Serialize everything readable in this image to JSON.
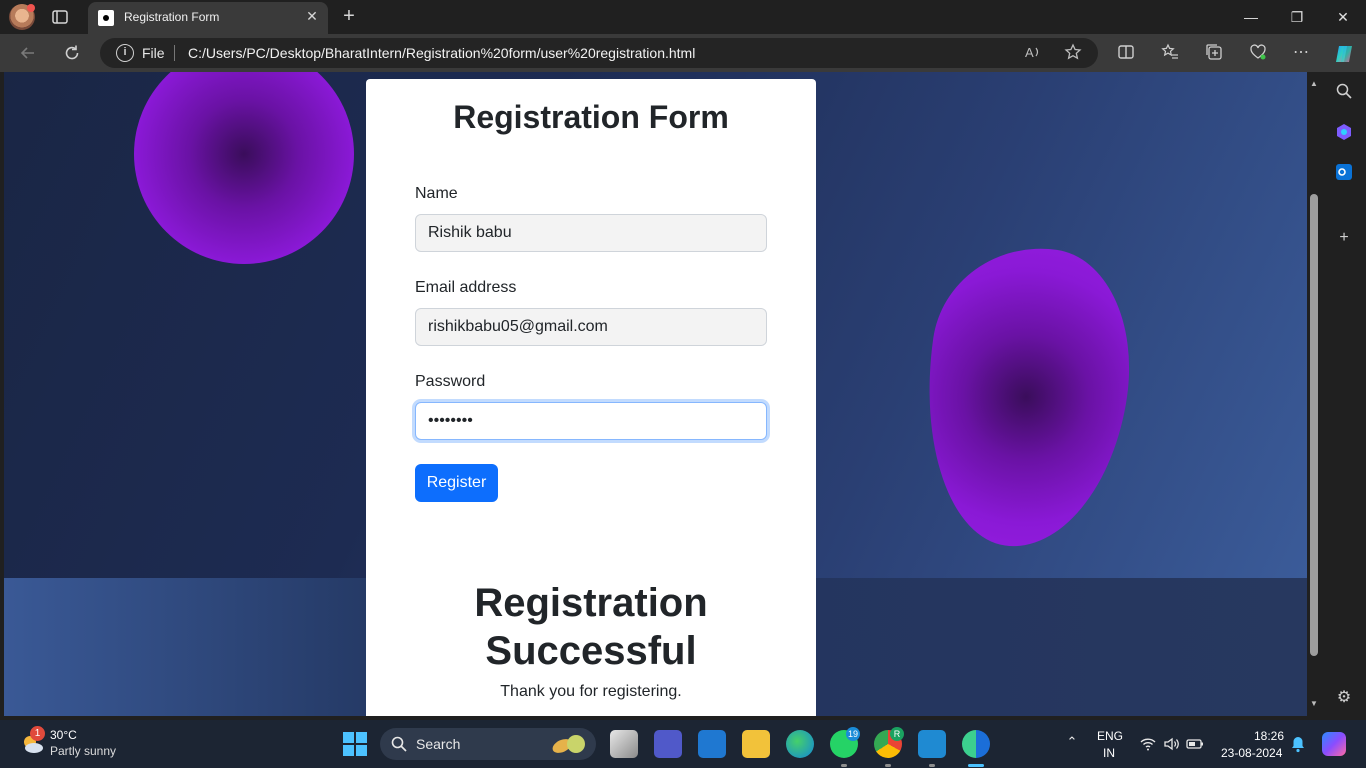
{
  "browser": {
    "tab_title": "Registration Form",
    "tab_close": "✕",
    "new_tab": "+",
    "address_scheme": "File",
    "address_url": "C:/Users/PC/Desktop/BharatIntern/Registration%20form/user%20registration.html",
    "window_controls": {
      "minimize": "—",
      "maximize": "❐",
      "close": "✕"
    }
  },
  "form": {
    "title": "Registration Form",
    "name_label": "Name",
    "name_value": "Rishik babu",
    "email_label": "Email address",
    "email_value": "rishikbabu05@gmail.com",
    "password_label": "Password",
    "password_value": "••••••••",
    "register_button": "Register"
  },
  "result": {
    "heading": "Registration Successful",
    "message": "Thank you for registering."
  },
  "taskbar": {
    "weather_temp": "30°C",
    "weather_desc": "Partly sunny",
    "weather_badge": "1",
    "search_label": "Search",
    "whatsapp_badge": "19",
    "chrome_badge": "R",
    "lang_line1": "ENG",
    "lang_line2": "IN",
    "time": "18:26",
    "date": "23-08-2024"
  },
  "colors": {
    "accent_blue": "#0d6efd",
    "blob_purple": "#8a19d6",
    "page_background": "#1d2b52",
    "taskbar_accent": "#4cc2ff"
  }
}
